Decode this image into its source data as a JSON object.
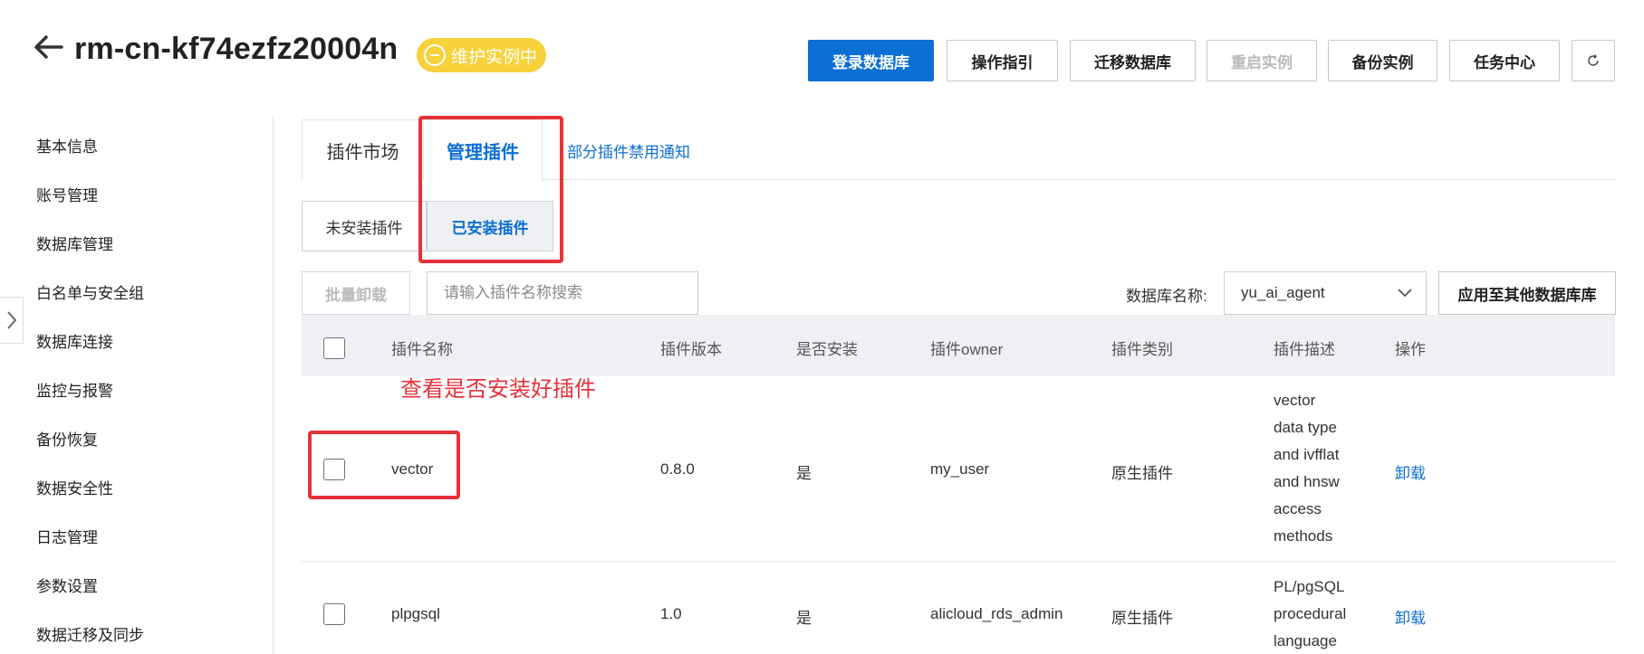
{
  "header": {
    "title": "rm-cn-kf74ezfz20004n",
    "status": "维护实例中",
    "buttons": {
      "login_db": "登录数据库",
      "guide": "操作指引",
      "migrate_db": "迁移数据库",
      "restart": "重启实例",
      "backup": "备份实例",
      "task_center": "任务中心"
    }
  },
  "sidebar": {
    "items": [
      {
        "label": "基本信息"
      },
      {
        "label": "账号管理"
      },
      {
        "label": "数据库管理"
      },
      {
        "label": "白名单与安全组"
      },
      {
        "label": "数据库连接"
      },
      {
        "label": "监控与报警"
      },
      {
        "label": "备份恢复"
      },
      {
        "label": "数据安全性"
      },
      {
        "label": "日志管理"
      },
      {
        "label": "参数设置"
      },
      {
        "label": "数据迁移及同步"
      }
    ]
  },
  "tabs": {
    "market": "插件市场",
    "manage": "管理插件",
    "notice": "部分插件禁用通知"
  },
  "subtabs": {
    "uninstalled": "未安装插件",
    "installed": "已安装插件"
  },
  "toolbar": {
    "batch_uninstall": "批量卸载",
    "search_placeholder": "请输入插件名称搜索",
    "db_label": "数据库名称:",
    "db_value": "yu_ai_agent",
    "apply_other": "应用至其他数据库库"
  },
  "table": {
    "headers": {
      "name": "插件名称",
      "version": "插件版本",
      "installed": "是否安装",
      "owner": "插件owner",
      "category": "插件类别",
      "description": "插件描述",
      "action": "操作"
    },
    "rows": [
      {
        "name": "vector",
        "version": "0.8.0",
        "installed": "是",
        "owner": "my_user",
        "category": "原生插件",
        "description": [
          "vector",
          "data type",
          "and ivfflat",
          "and hnsw",
          "access",
          "methods"
        ],
        "action": "卸载"
      },
      {
        "name": "plpgsql",
        "version": "1.0",
        "installed": "是",
        "owner": "alicloud_rds_admin",
        "category": "原生插件",
        "description": [
          "PL/pgSQL",
          "procedural",
          "language"
        ],
        "action": "卸载"
      }
    ]
  },
  "annotation": {
    "text": "查看是否安装好插件",
    "color": "#e8323c"
  },
  "colors": {
    "primary": "#0c6fd4",
    "status_badge": "#f7d23a"
  }
}
